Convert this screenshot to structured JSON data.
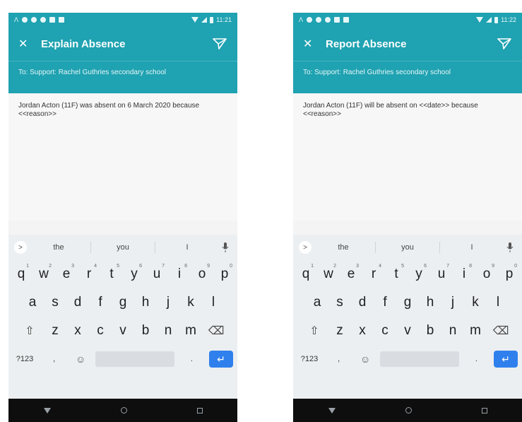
{
  "phones": [
    {
      "status_time": "11:21",
      "title": "Explain Absence",
      "to_line": "To: Support: Rachel Guthries secondary school",
      "message": "Jordan Acton (11F) was absent on 6 March 2020 because <<reason>>"
    },
    {
      "status_time": "11:22",
      "title": "Report Absence",
      "to_line": "To: Support: Rachel Guthries secondary school",
      "message": "Jordan Acton (11F) will be absent on <<date>> because <<reason>>"
    }
  ],
  "keyboard": {
    "suggestions": [
      "the",
      "you",
      "I"
    ],
    "row1": [
      "q",
      "w",
      "e",
      "r",
      "t",
      "y",
      "u",
      "i",
      "o",
      "p"
    ],
    "row1_hints": [
      "1",
      "2",
      "3",
      "4",
      "5",
      "6",
      "7",
      "8",
      "9",
      "0"
    ],
    "row2": [
      "a",
      "s",
      "d",
      "f",
      "g",
      "h",
      "j",
      "k",
      "l"
    ],
    "row3": [
      "z",
      "x",
      "c",
      "v",
      "b",
      "n",
      "m"
    ],
    "symbols_label": "?123",
    "comma": ",",
    "period": "."
  },
  "icons": {
    "close": "close-icon",
    "send": "send-icon",
    "mic": "mic-icon",
    "shift": "shift-icon",
    "backspace": "backspace-icon",
    "emoji": "emoji-icon",
    "enter": "enter-icon"
  },
  "colors": {
    "app_bar": "#1fa2b1",
    "enter_key": "#2f80ed"
  }
}
